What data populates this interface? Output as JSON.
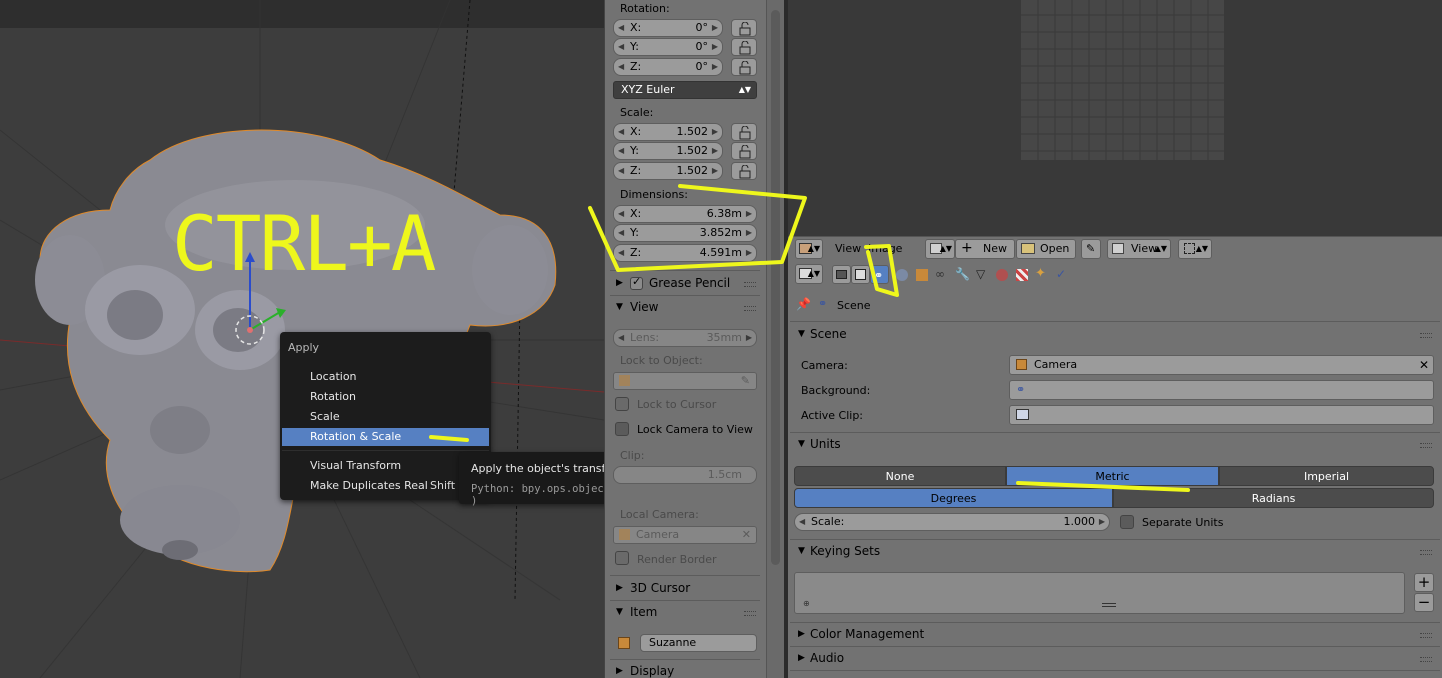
{
  "viewport": {
    "annotation": "CTRL+A",
    "apply_menu": {
      "title": "Apply",
      "items": [
        {
          "label": "Location",
          "shortcut": ""
        },
        {
          "label": "Rotation",
          "shortcut": ""
        },
        {
          "label": "Scale",
          "shortcut": ""
        },
        {
          "label": "Rotation & Scale",
          "shortcut": "",
          "active": true
        },
        {
          "label": "Visual Transform",
          "shortcut": ""
        },
        {
          "label": "Make Duplicates Real",
          "shortcut": "Shift C"
        }
      ]
    },
    "tooltip": {
      "title": "Apply the object's transformation to its data",
      "python": "Python: bpy.ops.object.transform_apply(location=False, ... )"
    }
  },
  "npanel": {
    "rotation_label": "Rotation:",
    "rotation": [
      {
        "axis": "X:",
        "value": "0°"
      },
      {
        "axis": "Y:",
        "value": "0°"
      },
      {
        "axis": "Z:",
        "value": "0°"
      }
    ],
    "rotation_mode": "XYZ Euler",
    "scale_label": "Scale:",
    "scale": [
      {
        "axis": "X:",
        "value": "1.502"
      },
      {
        "axis": "Y:",
        "value": "1.502"
      },
      {
        "axis": "Z:",
        "value": "1.502"
      }
    ],
    "dimensions_label": "Dimensions:",
    "dimensions": [
      {
        "axis": "X:",
        "value": "6.38m"
      },
      {
        "axis": "Y:",
        "value": "3.852m"
      },
      {
        "axis": "Z:",
        "value": "4.591m"
      }
    ],
    "grease_pencil": "Grease Pencil",
    "view_header": "View",
    "lens_label": "Lens:",
    "lens_value": "35mm",
    "lock_to_object": "Lock to Object:",
    "lock_to_cursor": "Lock to Cursor",
    "lock_camera_to_view": "Lock Camera to View",
    "clip_partial": "Clip:",
    "clip_value_partial": "1.5cm",
    "local_camera": "Local Camera:",
    "local_camera_value": "Camera",
    "render_border": "Render Border",
    "cursor_header": "3D Cursor",
    "item_header": "Item",
    "item_name": "Suzanne",
    "display_header": "Display"
  },
  "image_header": {
    "view_menu": "View",
    "image_menu": "Image",
    "new_button": "New",
    "open_button": "Open",
    "view_dropdown": "View"
  },
  "properties": {
    "breadcrumb": "Scene",
    "scene_section": {
      "title": "Scene",
      "camera_label": "Camera:",
      "camera_value": "Camera",
      "background_label": "Background:",
      "active_clip_label": "Active Clip:"
    },
    "units_section": {
      "title": "Units",
      "systems": [
        "None",
        "Metric",
        "Imperial"
      ],
      "active_system": "Metric",
      "rotation_units": [
        "Degrees",
        "Radians"
      ],
      "active_rotation": "Degrees",
      "scale_label": "Scale:",
      "scale_value": "1.000",
      "separate_units": "Separate Units"
    },
    "keying_sets_title": "Keying Sets",
    "color_management_title": "Color Management",
    "audio_title": "Audio"
  },
  "colors": {
    "annotation": "#eef71c",
    "selection_blue": "#5680c2",
    "panel_bg": "#727272"
  }
}
